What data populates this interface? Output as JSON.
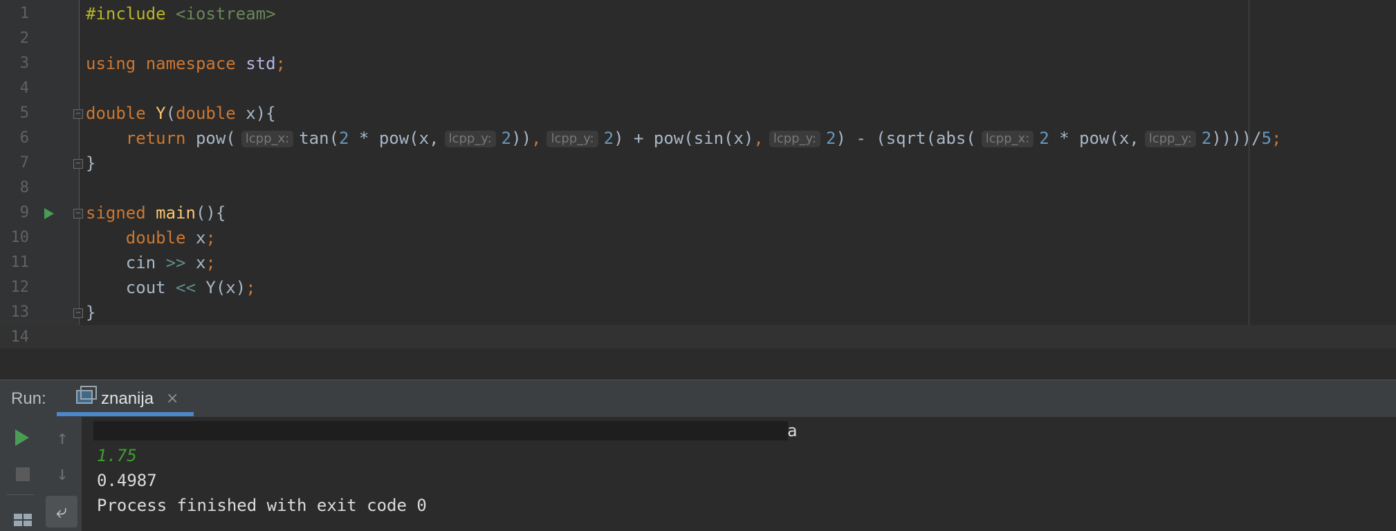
{
  "editor": {
    "line_numbers": [
      "1",
      "2",
      "3",
      "4",
      "5",
      "6",
      "7",
      "8",
      "9",
      "10",
      "11",
      "12",
      "13",
      "14"
    ],
    "lines": {
      "l1": {
        "pp": "#include",
        "inc": " <iostream>"
      },
      "l3": {
        "kw1": "using",
        "kw2": " namespace",
        "std": " std",
        "semi": ";"
      },
      "l5": {
        "type": "double",
        "fn": " Y",
        "p1": "(",
        "type2": "double",
        "rest": " x){"
      },
      "l6": {
        "indent": "    ",
        "kw": "return",
        "t1": " pow(",
        "h1": "lcpp_x:",
        "t2": "tan(",
        "n1": "2",
        "t3": " * pow(x,",
        "h2": "lcpp_y:",
        "n2": "2",
        "t4": "))",
        "c1": ",",
        "h3": "lcpp_y:",
        "n3": "2",
        "t5": ") + pow(sin(x)",
        "c2": ",",
        "h4": "lcpp_y:",
        "n4": "2",
        "t6": ") - (sqrt(abs(",
        "h5": "lcpp_x:",
        "n5": "2",
        "t7": " * pow(x,",
        "h6": "lcpp_y:",
        "n6": "2",
        "t8": "))))/",
        "n7": "5",
        "semi": ";"
      },
      "l7": "}",
      "l9": {
        "kw": "signed",
        "fn": " main",
        "rest": "(){"
      },
      "l10": {
        "indent": "    ",
        "type": "double",
        "rest": " x",
        "semi": ";"
      },
      "l11": {
        "indent": "    ",
        "a": "cin ",
        "op": ">>",
        "b": " x",
        "semi": ";"
      },
      "l12": {
        "indent": "    ",
        "a": "cout ",
        "op": "<<",
        "b": " Y(x)",
        "semi": ";"
      },
      "l13": "}"
    }
  },
  "run_panel": {
    "label": "Run:",
    "tab_name": "znanija",
    "tab_close": "×",
    "up_arrow": "↑",
    "down_arrow": "↓",
    "wrap_glyph": "⤶"
  },
  "console": {
    "redacted_tail": "a",
    "input_echo": "1.75",
    "result": "0.4987",
    "exit_message": "Process finished with exit code 0"
  },
  "colors": {
    "keyword": "#cc7832",
    "function": "#ffc66d",
    "number": "#6897bb",
    "preprocessor": "#bbb529",
    "include_path": "#6a8759",
    "input_echo": "#3f9e2f",
    "tab_accent": "#4a88c7"
  },
  "icons": [
    "run-triangle-icon",
    "fold-marker-icon",
    "console-window-icon",
    "close-icon",
    "play-icon",
    "stop-icon",
    "up-arrow-icon",
    "down-arrow-icon",
    "layout-icon",
    "soft-wrap-icon"
  ]
}
